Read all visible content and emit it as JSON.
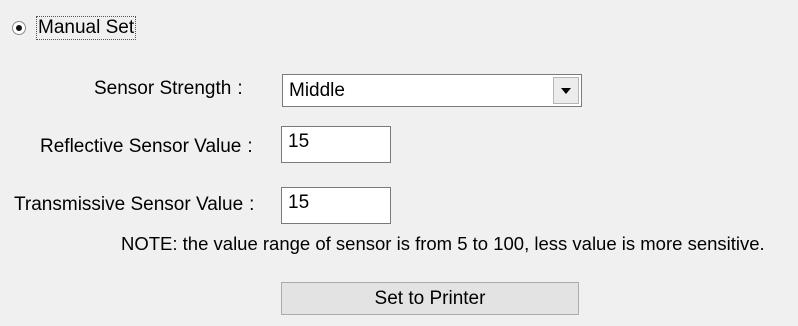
{
  "mode": {
    "label": "Manual Set",
    "selected": true
  },
  "sensor_strength": {
    "label": "Sensor Strength",
    "value": "Middle"
  },
  "reflective": {
    "label": "Reflective Sensor Value",
    "value": "15"
  },
  "transmissive": {
    "label": "Transmissive Sensor Value",
    "value": "15"
  },
  "colon": ":",
  "note": "NOTE: the value range of sensor is from 5 to 100, less value is more sensitive.",
  "set_button": "Set to Printer",
  "icons": {
    "radio": "radio-selected-icon",
    "dropdown": "chevron-down-icon"
  }
}
